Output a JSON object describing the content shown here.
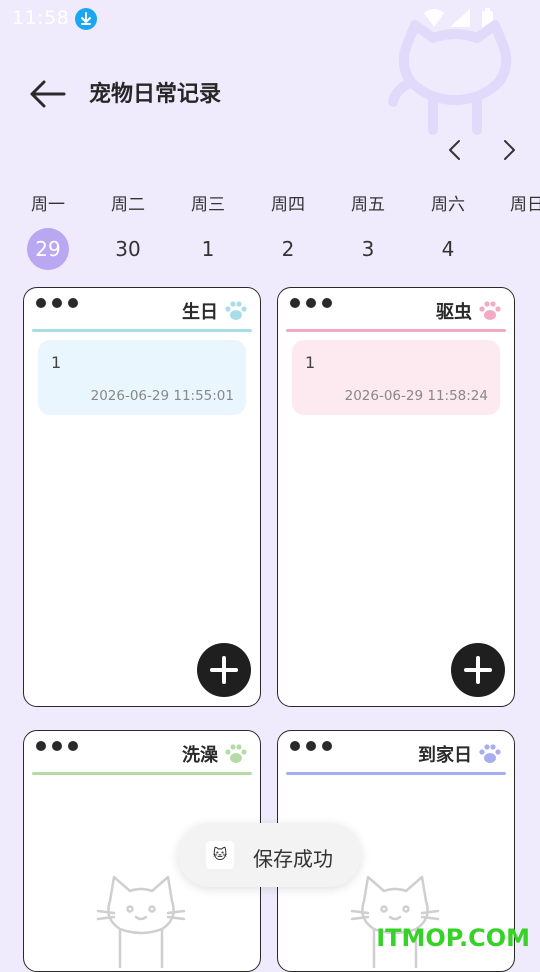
{
  "status_bar": {
    "time": "11:58",
    "download_icon": "download-icon",
    "icons": [
      "wifi-icon",
      "signal-icon",
      "battery-icon"
    ]
  },
  "header": {
    "title": "宠物日常记录",
    "back_icon": "arrow-left-icon"
  },
  "week_nav": {
    "prev_icon": "chevron-left-icon",
    "next_icon": "chevron-right-icon"
  },
  "week": {
    "days": [
      {
        "name": "周一",
        "num": "29",
        "selected": true
      },
      {
        "name": "周二",
        "num": "30"
      },
      {
        "name": "周三",
        "num": "1"
      },
      {
        "name": "周四",
        "num": "2"
      },
      {
        "name": "周五",
        "num": "3"
      },
      {
        "name": "周六",
        "num": "4"
      },
      {
        "name": "周日",
        "num": ""
      }
    ]
  },
  "cards": [
    {
      "title": "生日",
      "accent": "#a9dde8",
      "paw_color": "#a9dde8",
      "entry_bg": "#eaf6fd",
      "entries": [
        {
          "text": "1",
          "time": "2026-06-29 11:55:01"
        }
      ]
    },
    {
      "title": "驱虫",
      "accent": "#efa9c3",
      "paw_color": "#f4a9c4",
      "entry_bg": "#fde9f0",
      "entries": [
        {
          "text": "1",
          "time": "2026-06-29 11:58:24"
        }
      ]
    },
    {
      "title": "洗澡",
      "accent": "#b5dca6",
      "paw_color": "#b5dca6",
      "entry_bg": "",
      "entries": []
    },
    {
      "title": "到家日",
      "accent": "#a7aef0",
      "paw_color": "#a7aef0",
      "entry_bg": "",
      "entries": []
    }
  ],
  "toast": {
    "text": "保存成功",
    "icon": "app-icon"
  },
  "watermark": "ITMOP.COM",
  "colors": {
    "background": "#f0ebfc",
    "selected_day": "#b9a7f1",
    "add_button": "#1f1f1f"
  }
}
